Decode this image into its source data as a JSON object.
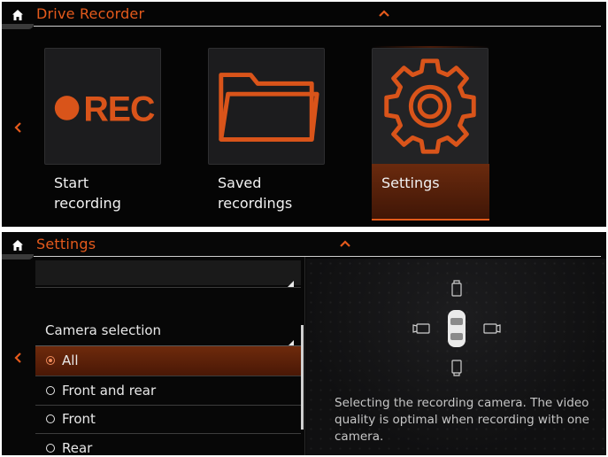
{
  "drive_recorder": {
    "title": "Drive Recorder",
    "tiles": [
      {
        "label_line1": "Start",
        "label_line2": "recording",
        "icon": "rec-icon",
        "icon_text": "REC"
      },
      {
        "label_line1": "Saved",
        "label_line2": "recordings",
        "icon": "folder-icon"
      },
      {
        "label_line1": "Settings",
        "label_line2": "",
        "icon": "gear-icon",
        "selected": true
      }
    ]
  },
  "settings": {
    "title": "Settings",
    "camera_selection_label": "Camera selection",
    "options": [
      {
        "label": "All",
        "selected": true
      },
      {
        "label": "Front and rear",
        "selected": false
      },
      {
        "label": "Front",
        "selected": false
      },
      {
        "label": "Rear",
        "selected": false
      }
    ],
    "description": "Selecting the recording camera. The video quality is optimal when recording with one camera."
  },
  "colors": {
    "accent": "#e55a1c",
    "background": "#0a0a0a",
    "text": "#f1f1f1"
  }
}
